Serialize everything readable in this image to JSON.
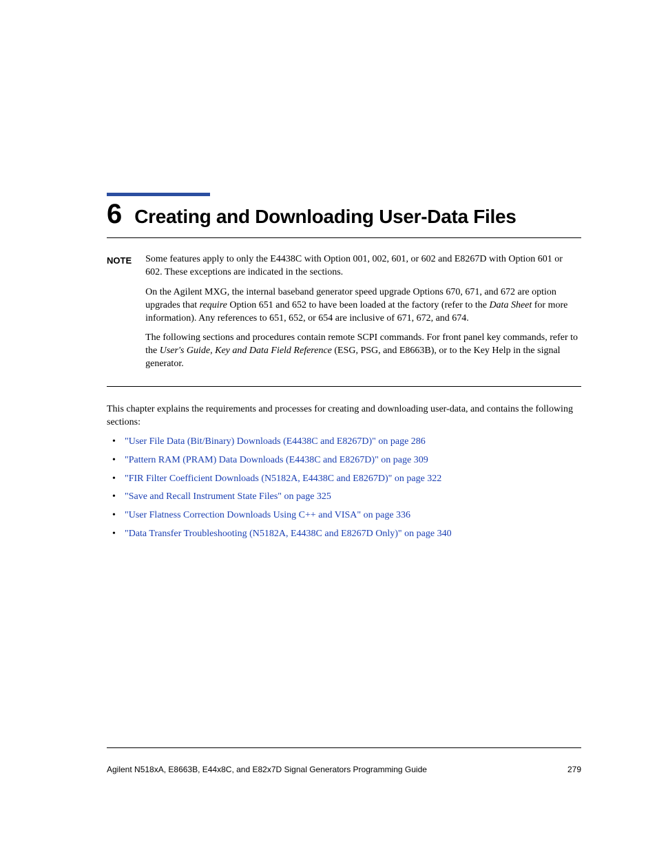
{
  "chapter": {
    "number": "6",
    "title": "Creating and Downloading User-Data Files"
  },
  "note": {
    "label": "NOTE",
    "p1": "Some features apply to only the E4438C with Option 001, 002, 601, or 602 and E8267D with Option 601 or 602. These exceptions are indicated in the sections.",
    "p2_a": "On the Agilent MXG, the internal baseband generator speed upgrade Options 670, 671, and 672 are option upgrades that ",
    "p2_i": "require",
    "p2_b": " Option 651 and 652 to have been loaded at the factory (refer to the ",
    "p2_i2": "Data Sheet",
    "p2_c": " for more information). Any references to 651, 652, or 654 are inclusive of 671, 672, and 674.",
    "p3_a": "The following sections and procedures contain remote SCPI commands. For front panel key commands, refer to the ",
    "p3_i1": "User's Guide",
    "p3_mid": ", ",
    "p3_i2": "Key and Data Field Reference",
    "p3_b": " (ESG, PSG, and E8663B), or to the Key Help in the signal generator."
  },
  "intro": "This chapter explains the requirements and processes for creating and downloading user-data, and contains the following sections:",
  "sections": [
    "\"User File Data (Bit/Binary) Downloads (E4438C and E8267D)\" on page 286",
    "\"Pattern RAM (PRAM) Data Downloads (E4438C and E8267D)\" on page 309",
    "\"FIR Filter Coefficient Downloads (N5182A, E4438C and E8267D)\" on page 322",
    "\"Save and Recall Instrument State Files\" on page 325",
    "\"User Flatness Correction Downloads Using C++ and VISA\" on page 336",
    "\"Data Transfer Troubleshooting (N5182A, E4438C and E8267D Only)\" on page 340"
  ],
  "footer": {
    "left": "Agilent N518xA, E8663B, E44x8C, and E82x7D Signal Generators Programming Guide",
    "right": "279"
  }
}
